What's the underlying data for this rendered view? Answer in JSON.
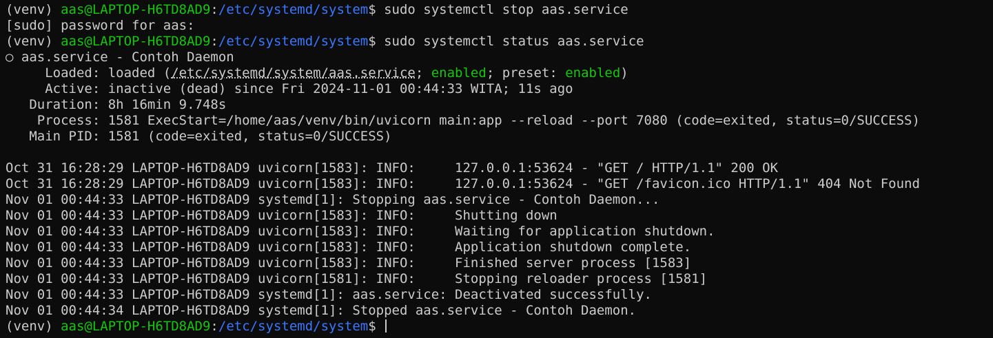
{
  "prompt": {
    "venv": "(venv) ",
    "user_host": "aas@LAPTOP-H6TD8AD9",
    "colon": ":",
    "path": "/etc/systemd/system",
    "symbol": "$ "
  },
  "commands": {
    "stop": "sudo systemctl stop aas.service",
    "status": "sudo systemctl status aas.service"
  },
  "sudo_prompt": "[sudo] password for aas:",
  "status": {
    "title": "○ aas.service - Contoh Daemon",
    "loaded_label": "     Loaded: ",
    "loaded_value": "loaded (",
    "loaded_path": "/etc/systemd/system/aas.service",
    "loaded_sep1": "; ",
    "loaded_enabled": "enabled",
    "loaded_sep2": "; preset: ",
    "loaded_preset": "enabled",
    "loaded_close": ")",
    "active": "     Active: inactive (dead) since Fri 2024-11-01 00:44:33 WITA; 11s ago",
    "duration": "   Duration: 8h 16min 9.748s",
    "process": "    Process: 1581 ExecStart=/home/aas/venv/bin/uvicorn main:app --reload --port 7080 (code=exited, status=0/SUCCESS)",
    "main_pid": "   Main PID: 1581 (code=exited, status=0/SUCCESS)"
  },
  "logs": [
    "Oct 31 16:28:29 LAPTOP-H6TD8AD9 uvicorn[1583]: INFO:     127.0.0.1:53624 - \"GET / HTTP/1.1\" 200 OK",
    "Oct 31 16:28:29 LAPTOP-H6TD8AD9 uvicorn[1583]: INFO:     127.0.0.1:53624 - \"GET /favicon.ico HTTP/1.1\" 404 Not Found",
    "Nov 01 00:44:33 LAPTOP-H6TD8AD9 systemd[1]: Stopping aas.service - Contoh Daemon...",
    "Nov 01 00:44:33 LAPTOP-H6TD8AD9 uvicorn[1583]: INFO:     Shutting down",
    "Nov 01 00:44:33 LAPTOP-H6TD8AD9 uvicorn[1583]: INFO:     Waiting for application shutdown.",
    "Nov 01 00:44:33 LAPTOP-H6TD8AD9 uvicorn[1583]: INFO:     Application shutdown complete.",
    "Nov 01 00:44:33 LAPTOP-H6TD8AD9 uvicorn[1583]: INFO:     Finished server process [1583]",
    "Nov 01 00:44:33 LAPTOP-H6TD8AD9 uvicorn[1581]: INFO:     Stopping reloader process [1581]",
    "Nov 01 00:44:33 LAPTOP-H6TD8AD9 systemd[1]: aas.service: Deactivated successfully.",
    "Nov 01 00:44:34 LAPTOP-H6TD8AD9 systemd[1]: Stopped aas.service - Contoh Daemon."
  ],
  "colors": {
    "background": "#0c0c0c",
    "text": "#cccccc",
    "green": "#16c60c",
    "blue": "#3b78ff"
  }
}
